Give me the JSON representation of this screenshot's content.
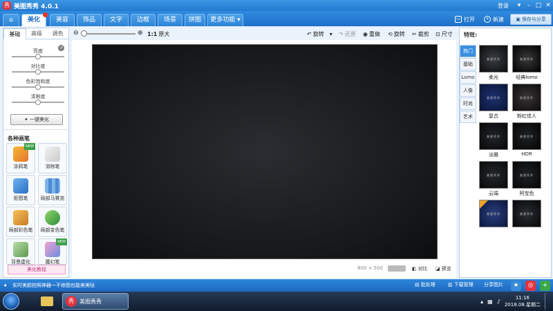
{
  "title": {
    "app_name": "美图秀秀 4.0.1",
    "logo_char": "秀",
    "login": "登录"
  },
  "nav": {
    "tabs": [
      "美化",
      "美容",
      "饰品",
      "文字",
      "边框",
      "场景",
      "拼图",
      "更多功能 ▾"
    ],
    "open": "打开",
    "new": "新建",
    "save": "保存与分享"
  },
  "left": {
    "tabs": [
      "基础",
      "高级",
      "调色"
    ],
    "sliders": [
      "亮度",
      "对比度",
      "色彩饱和度",
      "清晰度"
    ],
    "beauty_button": "一键美化",
    "section": "各种画笔",
    "brushes": [
      "涂鸦笔",
      "消除笔",
      "抠图笔",
      "局部马赛克",
      "局部彩色笔",
      "局部变色笔",
      "背景虚化",
      "魔幻笔"
    ],
    "more": "美化教程",
    "new_tag": "NEW"
  },
  "toolbar": {
    "zoom_label": "1:1",
    "original_size": "原大",
    "rotate": "旋转",
    "reset": "还原",
    "redo": "重做",
    "rotate2": "旋转",
    "crop": "裁剪",
    "resize": "尺寸"
  },
  "canvas": {
    "size": "800 × 500",
    "compare": "对比",
    "preview": "预览"
  },
  "right": {
    "heading": "特效:",
    "tabs": [
      "热门",
      "基础",
      "Lomo",
      "人像",
      "时尚",
      "艺术"
    ],
    "effects": [
      "柔光",
      "经典lomo",
      "复古",
      "粉红佳人",
      "淡雅",
      "HDR",
      "云端",
      "阿宝色"
    ],
    "thumb_text": "美图秀秀"
  },
  "status": {
    "tip": "实时美颜拍照神器一不修图也能美美哒",
    "batch": "批处理",
    "download": "下载管理",
    "share": "分享图片"
  },
  "taskbar": {
    "app_label": "美图秀秀",
    "time": "11:16",
    "date": "2018.08.星期二"
  },
  "colors": {
    "accent": "#2479cf",
    "brand_red": "#e4323e",
    "canvas_bg": "#16181a"
  }
}
